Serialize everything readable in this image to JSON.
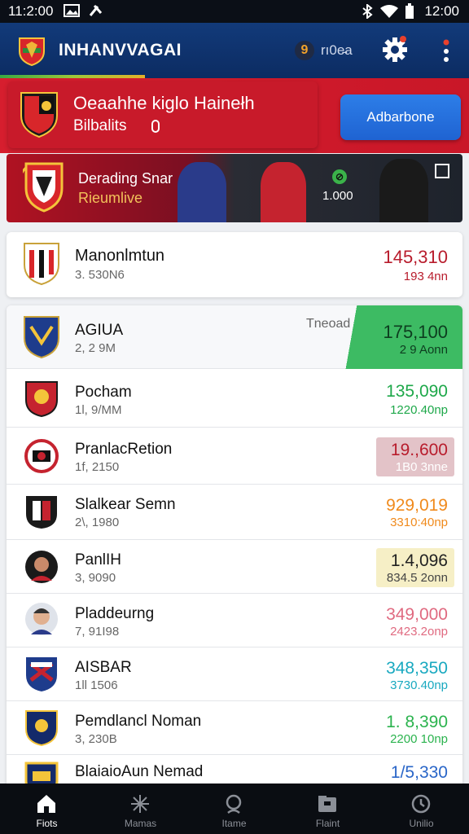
{
  "status_bar": {
    "time_left": "11:2:00",
    "time_right": "12:00"
  },
  "app_bar": {
    "title": "INHANVVAGAI",
    "coin_symbol": "9",
    "coin_label": "rı0e̵a"
  },
  "profile": {
    "title": "Oeaahhe kiglo Hainełh",
    "subtitle": "Bilbalits",
    "button_label": "Adbarbone"
  },
  "banner": {
    "title": "Derading Snar",
    "subtitle": "Rieumlive",
    "value": "1.000"
  },
  "featured": {
    "name": "Manonlmtun",
    "sub": "3. 530N6",
    "value": "145,310",
    "value_sub": "193 4nn"
  },
  "list": {
    "trend_label": "Tneoad",
    "rows": [
      {
        "name": "AGIUA",
        "sub": "2, 2 9M",
        "value": "175,100",
        "value_sub": "2 9 Aonn",
        "color": "#0d3d1f",
        "crest": "shield-blue"
      },
      {
        "name": "Pocham",
        "sub": "1l, 9/MM",
        "value": "135,090",
        "value_sub": "1220.40np",
        "color": "#1ea84a",
        "crest": "crest-red"
      },
      {
        "name": "PranlacRetion",
        "sub": "1f, 2150",
        "value": "19.,600",
        "value_sub": "1B0 3nne",
        "color": "#b81c2c",
        "crest": "crest-redblack"
      },
      {
        "name": "Slalkear Semn",
        "sub": "2\\, 1980",
        "value": "929,019",
        "value_sub": "3310:40np",
        "color": "#f08a1c",
        "crest": "crest-blackwhite"
      },
      {
        "name": "PanlIH",
        "sub": "3, 9090",
        "value": "1.4,096",
        "value_sub": "834.5 2onn",
        "color": "#222222",
        "crest": "avatar-player"
      },
      {
        "name": "Pladdeurng",
        "sub": "7, 91I98",
        "value": "349,000",
        "value_sub": "2423.2onp",
        "color": "#e06a80",
        "crest": "avatar-face"
      },
      {
        "name": "AISBAR",
        "sub": "1ll 1506",
        "value": "348,350",
        "value_sub": "3730.40np",
        "color": "#19a9c0",
        "crest": "crest-blue-red"
      },
      {
        "name": "Pemdlancl Noman",
        "sub": "3, 230B",
        "value": "1. 8,390",
        "value_sub": "2200 10np",
        "color": "#2bb34e",
        "crest": "crest-navy"
      },
      {
        "name": "BlaiaioAun Nemad",
        "sub": "",
        "value": "1/5,330",
        "value_sub": "",
        "color": "#2a66c8",
        "crest": "crest-navy-gold"
      }
    ]
  },
  "nav": {
    "items": [
      {
        "label": "Fiots",
        "icon": "home-icon",
        "active": true
      },
      {
        "label": "Mamas",
        "icon": "star-icon",
        "active": false
      },
      {
        "label": "Itame",
        "icon": "search-icon",
        "active": false
      },
      {
        "label": "Flaint",
        "icon": "folder-icon",
        "active": false
      },
      {
        "label": "Unilio",
        "icon": "clock-icon",
        "active": false
      }
    ]
  },
  "colors": {
    "appbar": "#0c2c62",
    "red": "#c81a2a",
    "button_blue": "#1f63d2",
    "green": "#3dbb63"
  }
}
